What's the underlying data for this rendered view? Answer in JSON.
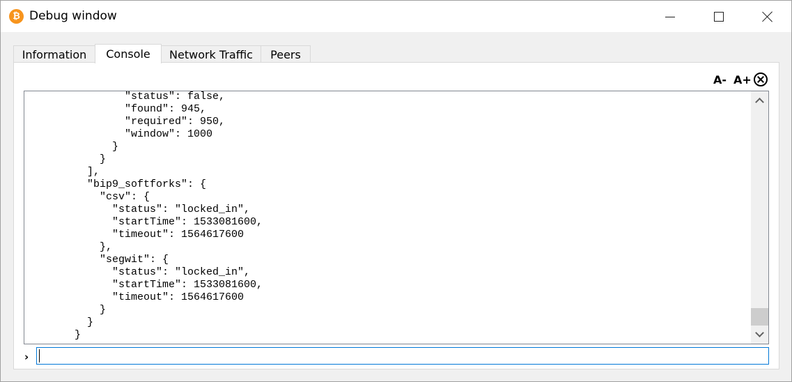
{
  "window": {
    "title": "Debug window",
    "app_icon_glyph": "₿",
    "app_icon_color": "#f7941d",
    "accent_color": "#0078d7"
  },
  "tabs": [
    {
      "label": "Information",
      "active": false
    },
    {
      "label": "Console",
      "active": true
    },
    {
      "label": "Network Traffic",
      "active": false
    },
    {
      "label": "Peers",
      "active": false
    }
  ],
  "toolbar": {
    "font_decrease_label": "A-",
    "font_increase_label": "A+",
    "clear_icon": "clear-circle-x-icon"
  },
  "console": {
    "lines": [
      "                \"status\": false,",
      "                \"found\": 945,",
      "                \"required\": 950,",
      "                \"window\": 1000",
      "              }",
      "            }",
      "          ],",
      "          \"bip9_softforks\": {",
      "            \"csv\": {",
      "              \"status\": \"locked_in\",",
      "              \"startTime\": 1533081600,",
      "              \"timeout\": 1564617600",
      "            },",
      "            \"segwit\": {",
      "              \"status\": \"locked_in\",",
      "              \"startTime\": 1533081600,",
      "              \"timeout\": 1564617600",
      "            }",
      "          }",
      "        }"
    ],
    "prompt_symbol": "›",
    "input_value": ""
  }
}
